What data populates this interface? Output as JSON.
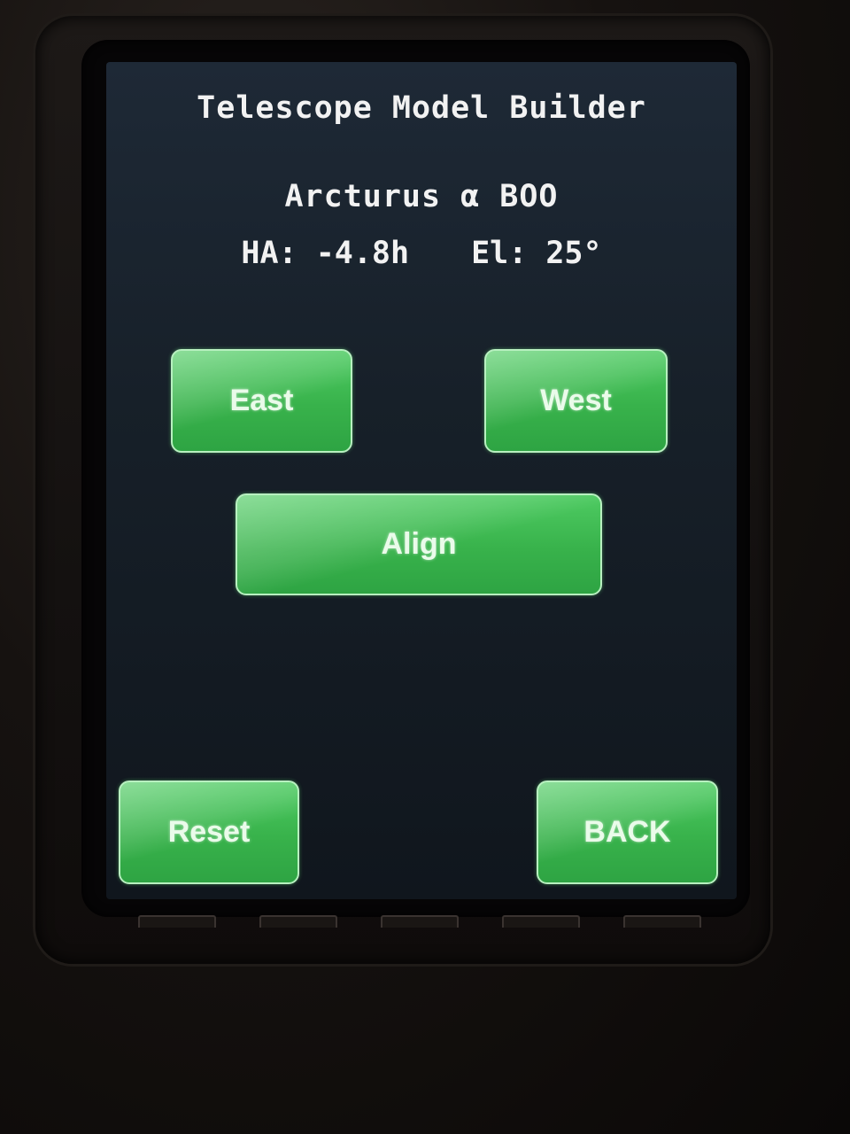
{
  "screen": {
    "title": "Telescope Model Builder",
    "star_name": "Arcturus α BOO",
    "hour_angle": "HA: -4.8h",
    "elevation": "El: 25°"
  },
  "buttons": {
    "east": "East",
    "west": "West",
    "align": "Align",
    "reset": "Reset",
    "back": "BACK"
  },
  "colors": {
    "button_green": "#38b24b",
    "screen_background": "#172029",
    "text": "#f2f2f2"
  }
}
